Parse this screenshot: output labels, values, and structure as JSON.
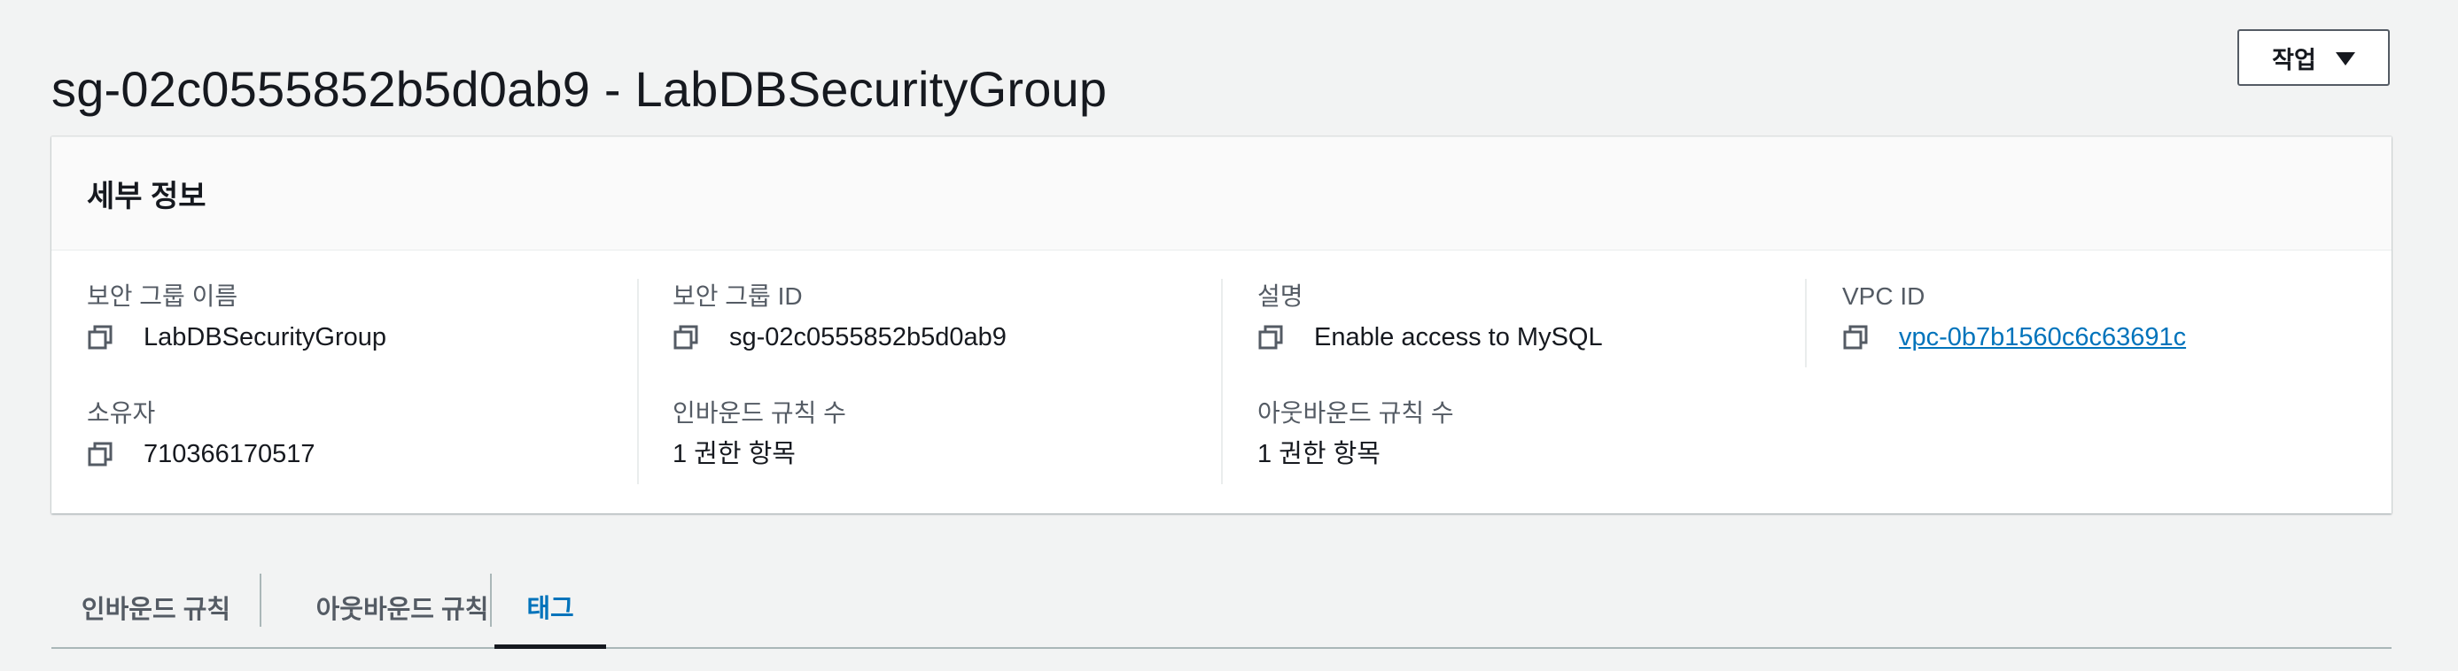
{
  "page": {
    "title": "sg-02c0555852b5d0ab9 - LabDBSecurityGroup"
  },
  "actions": {
    "label": "작업"
  },
  "details": {
    "title": "세부 정보",
    "fields": {
      "name": {
        "label": "보안 그룹 이름",
        "value": "LabDBSecurityGroup"
      },
      "id": {
        "label": "보안 그룹 ID",
        "value": "sg-02c0555852b5d0ab9"
      },
      "description": {
        "label": "설명",
        "value": "Enable access to MySQL"
      },
      "vpc": {
        "label": "VPC ID",
        "value": "vpc-0b7b1560c6c63691c"
      },
      "owner": {
        "label": "소유자",
        "value": "710366170517"
      },
      "inbound_count": {
        "label": "인바운드 규칙 수",
        "value": "1 권한 항목"
      },
      "outbound_count": {
        "label": "아웃바운드 규칙 수",
        "value": "1 권한 항목"
      }
    }
  },
  "tabs": [
    {
      "label": "인바운드 규칙",
      "active": false
    },
    {
      "label": "아웃바운드 규칙",
      "active": false
    },
    {
      "label": "태그",
      "active": true
    }
  ],
  "colors": {
    "background": "#f2f3f3",
    "link": "#0073bb",
    "text": "#16191f",
    "muted": "#545b64"
  },
  "icons": {
    "copy": "copy-icon",
    "dropdown": "caret-down-icon"
  }
}
